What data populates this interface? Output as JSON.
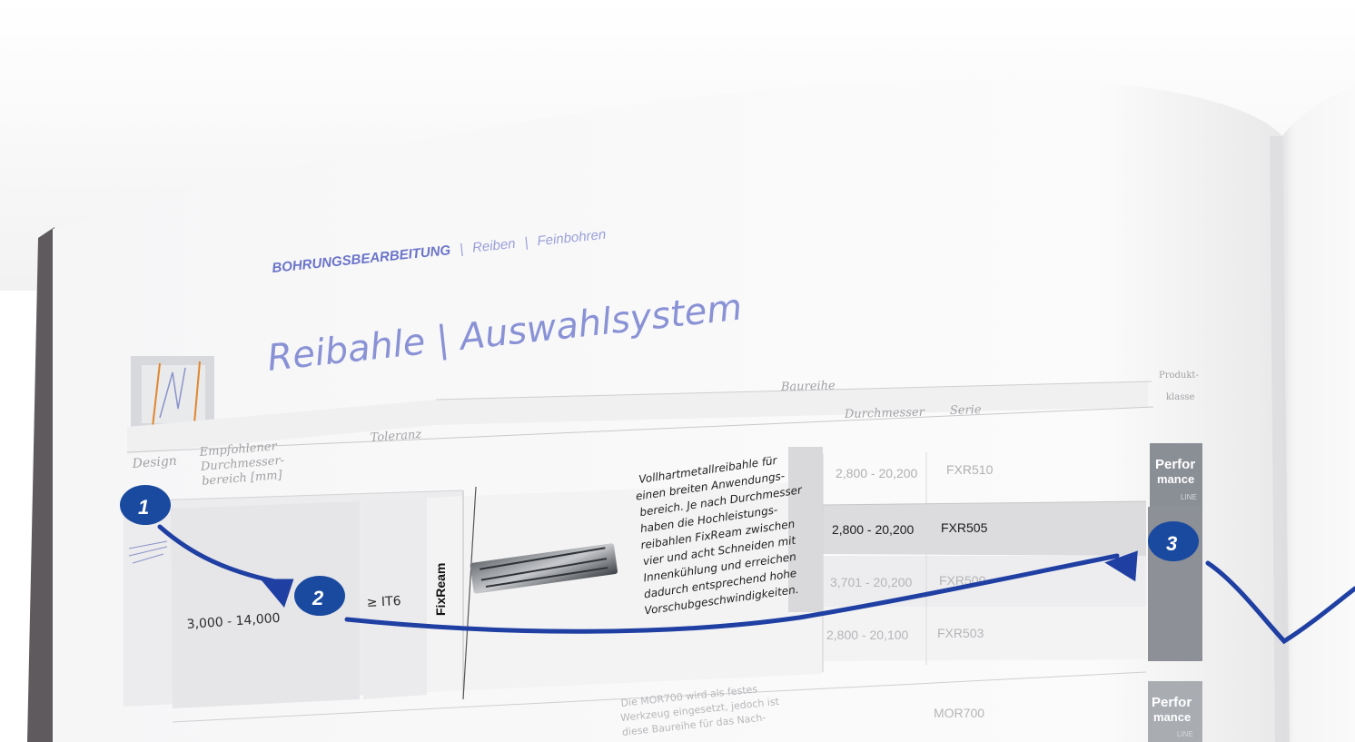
{
  "header": {
    "section": "BOHRUNGSBEARBEITUNG",
    "sub1": "Reiben",
    "sub2": "Feinbohren",
    "separator": "|"
  },
  "title": "Reibahle | Auswahlsystem",
  "table": {
    "col_design": "Design",
    "col_diameter_lines": [
      "Empfohlener",
      "Durchmesser-",
      "bereich [mm]"
    ],
    "col_tolerance": "Toleranz",
    "col_series_group": "Baureihe",
    "col_series_diameter": "Durchmesser",
    "col_series_name": "Serie",
    "col_class_lines": [
      "Produkt-",
      "klasse"
    ],
    "row_range": "3,000 - 14,000",
    "row_tolerance": "≥ IT6",
    "row_brand": "FixReam",
    "description_lines": [
      "Vollhartmetallreibahle für",
      "einen breiten Anwendungs-",
      "bereich. Je nach Durchmesser",
      "haben die Hochleistungs-",
      "reibahlen FixReam zwischen",
      "vier und acht Schneiden mit",
      "Innenkühlung und erreichen",
      "dadurch entsprechend hohe",
      "Vorschubgeschwindigkeiten."
    ],
    "series": [
      {
        "diameter": "2,800 - 20,200",
        "name": "FXR510"
      },
      {
        "diameter": "2,800 - 20,200",
        "name": "FXR505"
      },
      {
        "diameter": "3,701 - 20,200",
        "name": "FXR500"
      },
      {
        "diameter": "2,800 - 20,100",
        "name": "FXR503"
      }
    ],
    "next_series": {
      "name": "MOR700"
    },
    "next_description_lines": [
      "Die MOR700 wird als festes",
      "Werkzeug eingesetzt, jedoch ist",
      "diese Baureihe für das Nach-"
    ],
    "class_badge_lines": [
      "Perfor",
      "mance",
      "LINE"
    ]
  },
  "markers": [
    "1",
    "2",
    "3"
  ],
  "colors": {
    "accent_blue": "#6b74c9",
    "marker_blue": "#1a4aa0",
    "line_blue": "#1f3fa3",
    "text_gray": "#9a9a9a",
    "badge_gray": "#8a8f96"
  }
}
